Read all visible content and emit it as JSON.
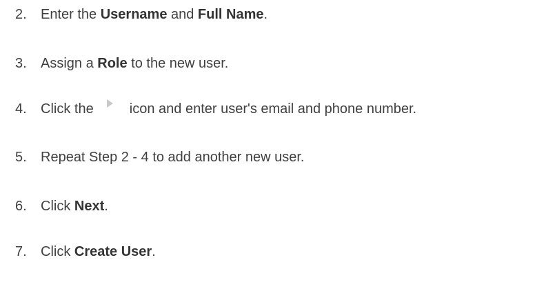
{
  "steps": [
    {
      "number": "2.",
      "parts": {
        "t1": "Enter the ",
        "b1": "Username",
        "t2": " and ",
        "b2": "Full Name",
        "t3": "."
      }
    },
    {
      "number": "3.",
      "parts": {
        "t1": "Assign a ",
        "b1": "Role",
        "t2": " to the new user."
      }
    },
    {
      "number": "4.",
      "parts": {
        "t1": "Click the ",
        "icon": "expand-arrow-icon",
        "t2": " icon and enter user's email and phone number."
      }
    },
    {
      "number": "5.",
      "parts": {
        "t1": "Repeat Step 2 - 4 to add another new user."
      }
    },
    {
      "number": "6.",
      "parts": {
        "t1": "Click ",
        "b1": "Next",
        "t2": "."
      }
    },
    {
      "number": "7.",
      "parts": {
        "t1": "Click ",
        "b1": "Create User",
        "t2": "."
      }
    }
  ],
  "colors": {
    "text": "#404040",
    "icon": "#c9c9c9"
  }
}
